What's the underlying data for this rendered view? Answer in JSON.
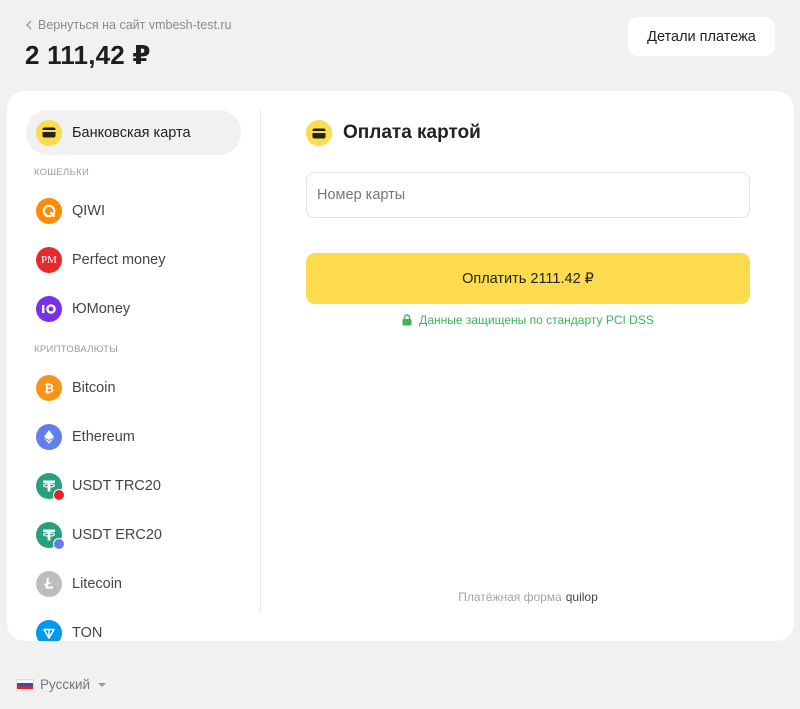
{
  "header": {
    "back_label": "Вернуться на сайт vmbesh-test.ru",
    "amount": "2 111,42 ₽",
    "details_label": "Детали платежа"
  },
  "sidebar": {
    "bank_card": "Банковская карта",
    "wallets_label": "КОШЕЛЬКИ",
    "wallets": [
      {
        "label": "QIWI",
        "icon": "qiwi-icon"
      },
      {
        "label": "Perfect money",
        "icon": "perfect-money-icon"
      },
      {
        "label": "ЮMoney",
        "icon": "yoomoney-icon"
      }
    ],
    "crypto_label": "КРИПТОВАЛЮТЫ",
    "crypto": [
      {
        "label": "Bitcoin",
        "icon": "bitcoin-icon"
      },
      {
        "label": "Ethereum",
        "icon": "ethereum-icon"
      },
      {
        "label": "USDT TRC20",
        "icon": "usdt-trc20-icon"
      },
      {
        "label": "USDT ERC20",
        "icon": "usdt-erc20-icon"
      },
      {
        "label": "Litecoin",
        "icon": "litecoin-icon"
      },
      {
        "label": "TON",
        "icon": "ton-icon"
      }
    ]
  },
  "main": {
    "title": "Оплата картой",
    "card_placeholder": "Номер карты",
    "pay_label": "Оплатить 2111.42 ₽",
    "secure_text": "Данные защищены по стандарту PCI DSS",
    "footer_text": "Платёжная форма",
    "footer_brand": "quilop",
    "pm_logo_text": "PM"
  },
  "language": {
    "label": "Русский"
  },
  "colors": {
    "accent": "#fddb4e",
    "secure": "#3cb55a",
    "background": "#f1f1f1"
  }
}
